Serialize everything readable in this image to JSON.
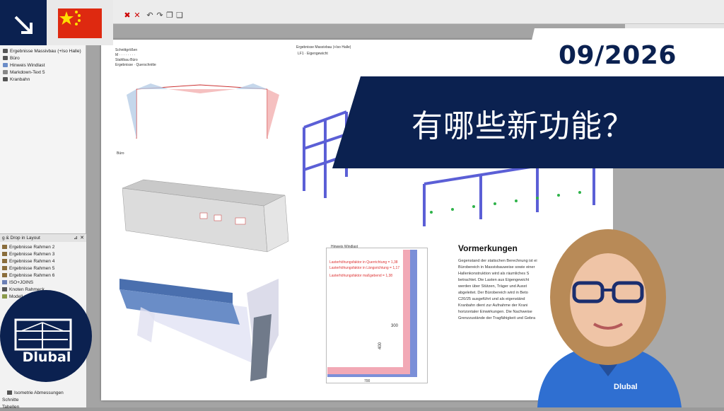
{
  "toolbar": {
    "title_fragment": ""
  },
  "navigator": {
    "items": [
      {
        "label": "Ergebnisse Massivbau (+Iso Halle)",
        "icon": "camera-icon"
      },
      {
        "label": "Büro",
        "icon": "camera-icon"
      },
      {
        "label": "Hinweis Windlast",
        "icon": "picture-icon"
      },
      {
        "label": "Markdown-Text 5",
        "icon": "text-icon"
      },
      {
        "label": "Kranbahn",
        "icon": "camera-icon"
      }
    ]
  },
  "layout_panel": {
    "title": "g & Drop in Layout",
    "items": [
      {
        "label": "Ergebnisse Rahmen 2",
        "color": "#8a6d3b"
      },
      {
        "label": "Ergebnisse Rahmen 3",
        "color": "#8a6d3b"
      },
      {
        "label": "Ergebnisse Rahmen 4",
        "color": "#8a6d3b"
      },
      {
        "label": "Ergebnisse Rahmen 5",
        "color": "#8a6d3b"
      },
      {
        "label": "Ergebnisse Rahmen 6",
        "color": "#8a6d3b"
      },
      {
        "label": "ISO+JOINS",
        "color": "#6b7fb5"
      },
      {
        "label": "Knoten Rahmeck",
        "color": "#555555"
      },
      {
        "label": "Modell",
        "color": "#8a9a4a"
      }
    ],
    "bottom_items": [
      {
        "label": "Isometrie Abmessungen",
        "color": "#555555"
      },
      {
        "label": "Schnitte",
        "color": ""
      },
      {
        "label": "Tabellen",
        "color": ""
      }
    ]
  },
  "page": {
    "header_left_lines": [
      "Schnittgrößen",
      "M   ·  ·  ·  ·  ·  ·  ·  ·",
      "Stahlbau Büro",
      "Ergebnisse · Querschnitte"
    ],
    "header_center": "Ergebnisse Massivbau (+Iso Halle)",
    "header_center_sub": "LF1 · Eigengewicht",
    "buro_label": "Büro",
    "hinweis_label": "Hinweis Windlast",
    "wind_lines": [
      "Lasterhöhungsfaktor in Querrichtung = 1,38",
      "Lasterhöhungsfaktor in Längsrichtung = 1,17",
      "Lasterhöhungsfaktor maßgebend = 1,38"
    ],
    "dim_300": "300",
    "dim_400": "400",
    "dim_700": "700"
  },
  "vormerkungen": {
    "title": "Vormerkungen",
    "lines": [
      "Gegenstand der statischen Berechnung ist ei",
      "Bürobereich in Massivbauweise sowie einer",
      "Hallenkonstruktion wird als räumliches S",
      "betrachtet. Die Lasten aus Eigengewicht",
      "werden über Stützen, Träger und Ausst",
      "abgeleitet. Der Bürobereich wird in Beto",
      "C20/25 ausgeführt und als eigenständ",
      "Kranbahn dient zur Aufnahme der Krani",
      "horizontaler Einwirkungen. Die Nachweise",
      "Grenzzustände der Tragfähigkeit und Gebra"
    ]
  },
  "banner": {
    "date": "09/2026",
    "title": "有哪些新功能？"
  },
  "brand": {
    "name": "Dlubal",
    "shirt_label": "Dlubal",
    "navy": "#0b2150",
    "accent_blue": "#2f6fd1"
  }
}
